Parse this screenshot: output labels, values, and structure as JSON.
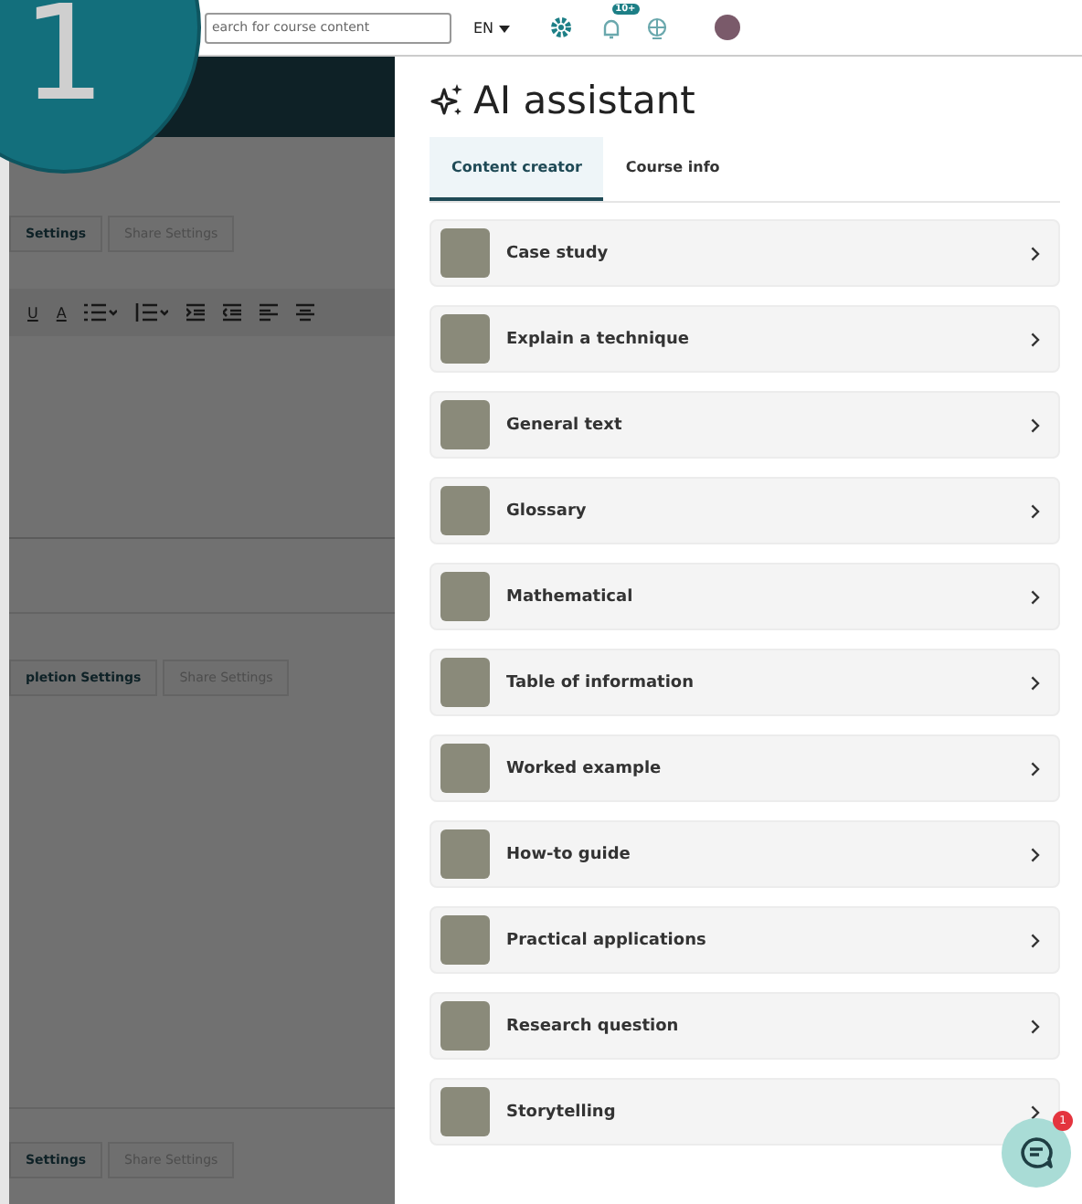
{
  "step_badge": "1",
  "top_bar": {
    "search": {
      "placeholder": "earch for course content"
    },
    "language": "EN",
    "notification_count": "10+"
  },
  "background_page": {
    "upper_tabs": [
      "Settings",
      "Share Settings"
    ],
    "toolbar_letters": [
      "U",
      "A"
    ],
    "middle_tabs": [
      "pletion Settings",
      "Share Settings"
    ],
    "lower_tabs": [
      "Settings",
      "Share Settings"
    ]
  },
  "assistant": {
    "title": "AI assistant",
    "tabs": [
      {
        "label": "Content creator",
        "selected": true
      },
      {
        "label": "Course info",
        "selected": false
      }
    ],
    "templates": [
      {
        "label": "Case study"
      },
      {
        "label": "Explain a technique"
      },
      {
        "label": "General text"
      },
      {
        "label": "Glossary"
      },
      {
        "label": "Mathematical"
      },
      {
        "label": "Table of information"
      },
      {
        "label": "Worked example"
      },
      {
        "label": "How-to guide"
      },
      {
        "label": "Practical applications"
      },
      {
        "label": "Research question"
      },
      {
        "label": "Storytelling"
      }
    ]
  },
  "chat": {
    "badge": "1"
  }
}
